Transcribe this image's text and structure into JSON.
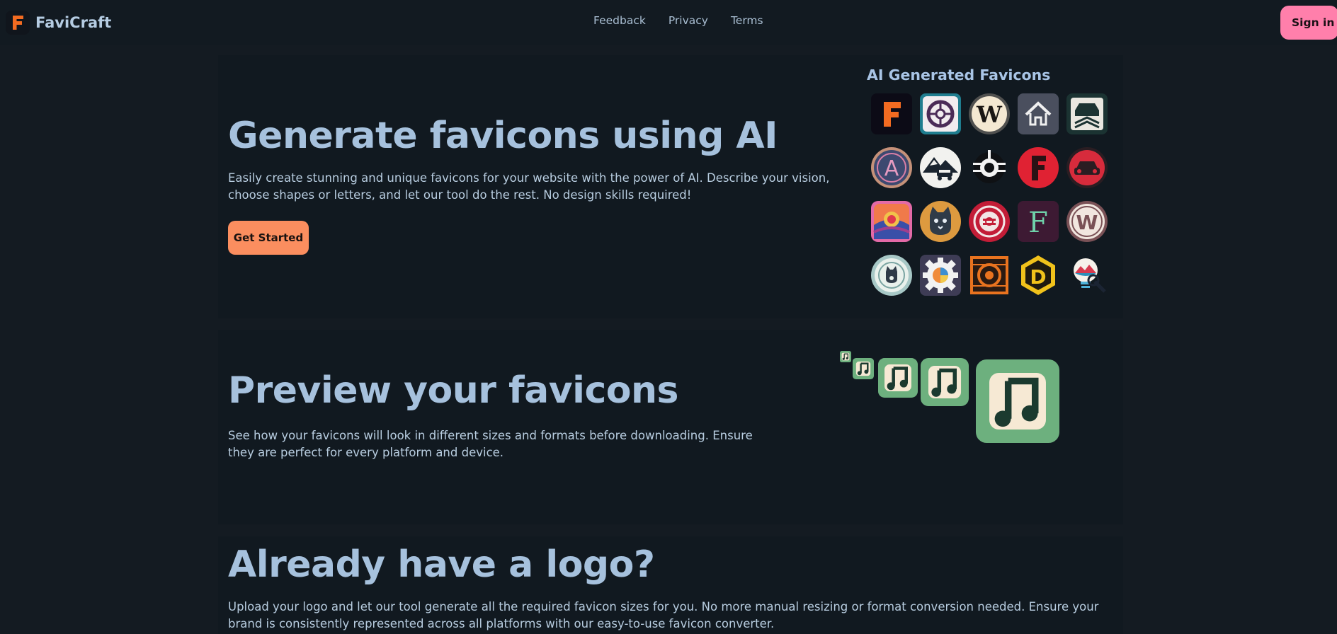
{
  "header": {
    "brand": "FaviCraft",
    "brand_icon": "letter-f-logo-icon",
    "nav": [
      {
        "label": "Feedback"
      },
      {
        "label": "Privacy"
      },
      {
        "label": "Terms"
      }
    ],
    "signin_label": "Sign in"
  },
  "hero": {
    "title": "Generate favicons using AI",
    "description": "Easily create stunning and unique favicons for your website with the power of AI. Describe your vision, choose shapes or letters, and let our tool do the rest. No design skills required!",
    "cta_label": "Get Started",
    "gallery_title": "AI Generated Favicons",
    "gallery": [
      "orange-letter-f-icon",
      "purple-lifebuoy-icon",
      "cream-letter-w-icon",
      "grey-house-icon",
      "dark-car-emblem-icon",
      "circle-letter-a-icon",
      "mountain-road-car-icon",
      "black-white-sun-icon",
      "red-letter-f-icon",
      "red-car-icon",
      "rainbow-location-pin-icon",
      "orange-cat-icon",
      "red-target-icon",
      "green-letter-f-icon",
      "cream-letter-w-ring-icon",
      "teal-cat-circle-icon",
      "gear-color-wheel-icon",
      "orange-square-rings-icon",
      "yellow-letter-d-icon",
      "lightbulb-mountain-icon"
    ]
  },
  "preview": {
    "title": "Preview your favicons",
    "description": "See how your favicons will look in different sizes and formats before downloading. Ensure they are perfect for every platform and device.",
    "preview_icon": "music-note-icon"
  },
  "upload": {
    "title": "Already have a logo?",
    "description": "Upload your logo and let our tool generate all the required favicon sizes for you. No more manual resizing or format conversion needed. Ensure your brand is consistently represented across all platforms with our easy-to-use favicon converter."
  },
  "colors": {
    "background": "#141b22",
    "accent_pink": "#ff7fab",
    "accent_orange": "#fb8e5f",
    "heading_blue": "#a6c1dd"
  }
}
